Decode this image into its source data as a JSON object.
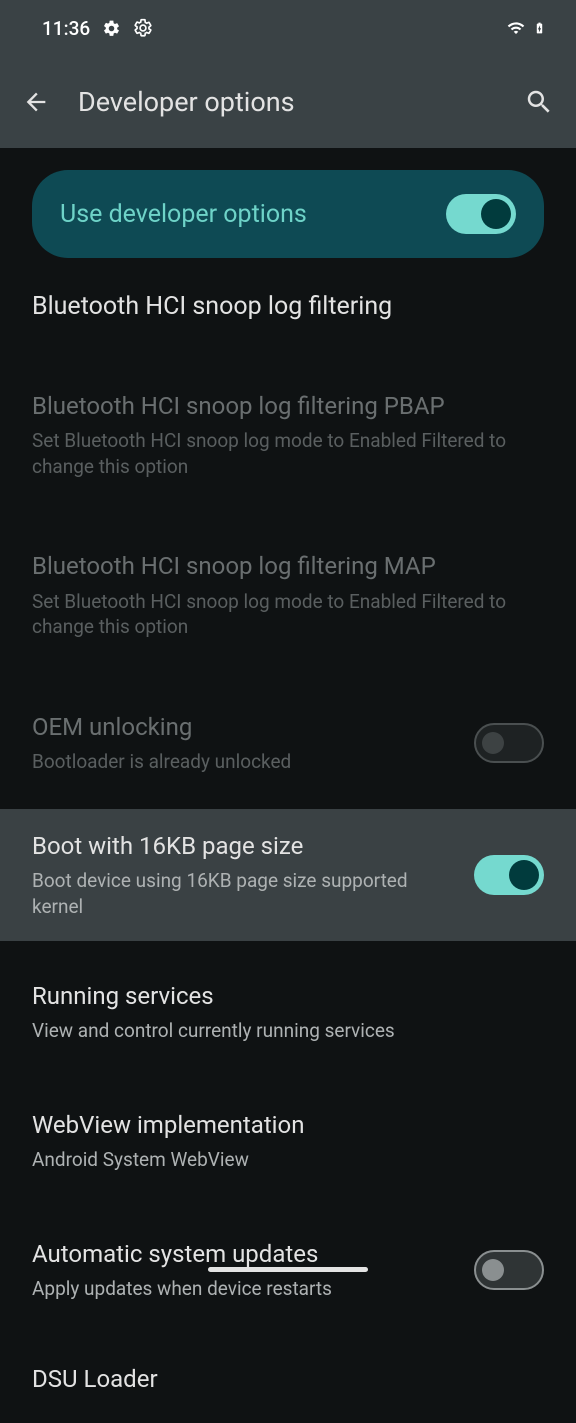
{
  "status": {
    "time": "11:36"
  },
  "header": {
    "title": "Developer options"
  },
  "master": {
    "label": "Use developer options",
    "on": true
  },
  "section": {
    "bt_filtering_header": "Bluetooth HCI snoop log filtering"
  },
  "items": {
    "pbap": {
      "title": "Bluetooth HCI snoop log filtering PBAP",
      "subtitle": "Set Bluetooth HCI snoop log mode to Enabled Filtered to change this option"
    },
    "map": {
      "title": "Bluetooth HCI snoop log filtering MAP",
      "subtitle": "Set Bluetooth HCI snoop log mode to Enabled Filtered to change this option"
    },
    "oem": {
      "title": "OEM unlocking",
      "subtitle": "Bootloader is already unlocked"
    },
    "boot16": {
      "title": "Boot with 16KB page size",
      "subtitle": "Boot device using 16KB page size supported kernel"
    },
    "running": {
      "title": "Running services",
      "subtitle": "View and control currently running services"
    },
    "webview": {
      "title": "WebView implementation",
      "subtitle": "Android System WebView"
    },
    "autoupdate": {
      "title": "Automatic system updates",
      "subtitle": "Apply updates when device restarts"
    },
    "dsu": {
      "title": "DSU Loader"
    }
  }
}
